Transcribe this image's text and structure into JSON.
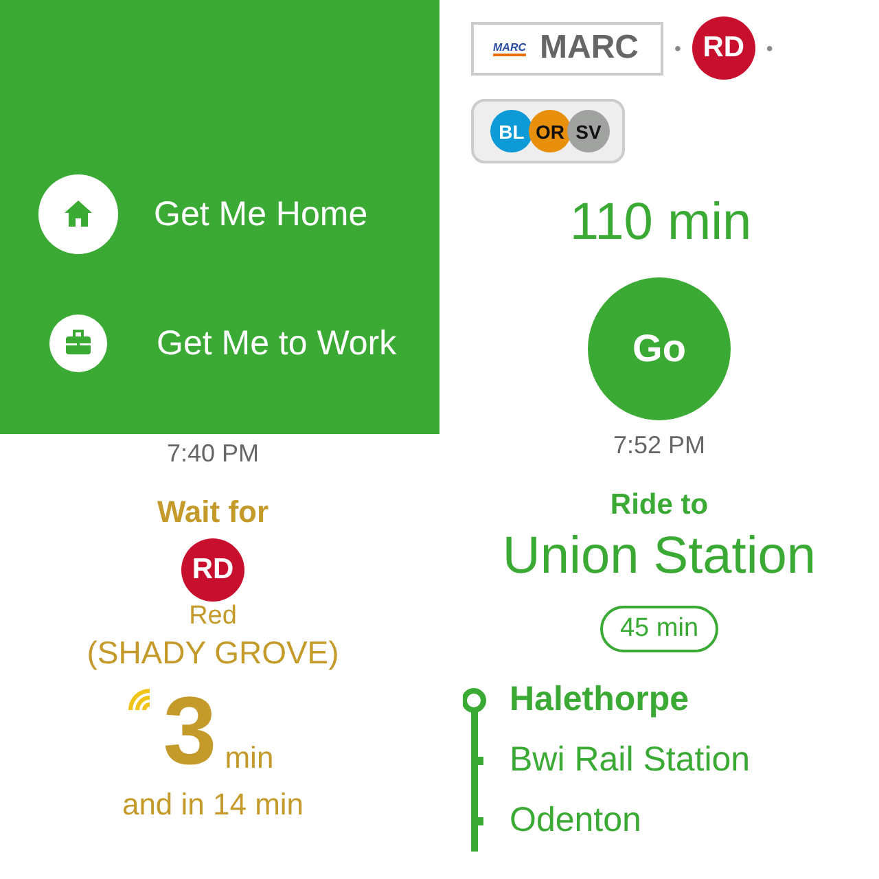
{
  "menu": [
    {
      "kind": "home",
      "label": "Get Me Home"
    },
    {
      "kind": "work",
      "label": "Get Me to Work"
    }
  ],
  "routes": {
    "marc": {
      "logo": "MARC",
      "label": "MARC"
    },
    "separator": "•",
    "red": {
      "code": "RD",
      "color": "#c8102e"
    },
    "lines": [
      {
        "code": "BL",
        "color": "#0d9ad7"
      },
      {
        "code": "OR",
        "color": "#e8900c"
      },
      {
        "code": "SV",
        "color": "#a0a2a0"
      }
    ]
  },
  "duration": "110 min",
  "go": "Go",
  "wait": {
    "time": "7:40 PM",
    "heading": "Wait for",
    "line": {
      "code": "RD",
      "color": "#c8102e"
    },
    "line_name": "Red",
    "direction": "(SHADY GROVE)",
    "realtime": true,
    "minutes": "3",
    "unit": "min",
    "next": "and in 14 min"
  },
  "ride": {
    "time": "7:52 PM",
    "heading": "Ride to",
    "destination": "Union Station",
    "ride_time": "45 min",
    "stops": [
      {
        "name": "Halethorpe",
        "kind": "origin"
      },
      {
        "name": "Bwi Rail Station",
        "kind": "stop"
      },
      {
        "name": "Odenton",
        "kind": "stop"
      }
    ]
  }
}
